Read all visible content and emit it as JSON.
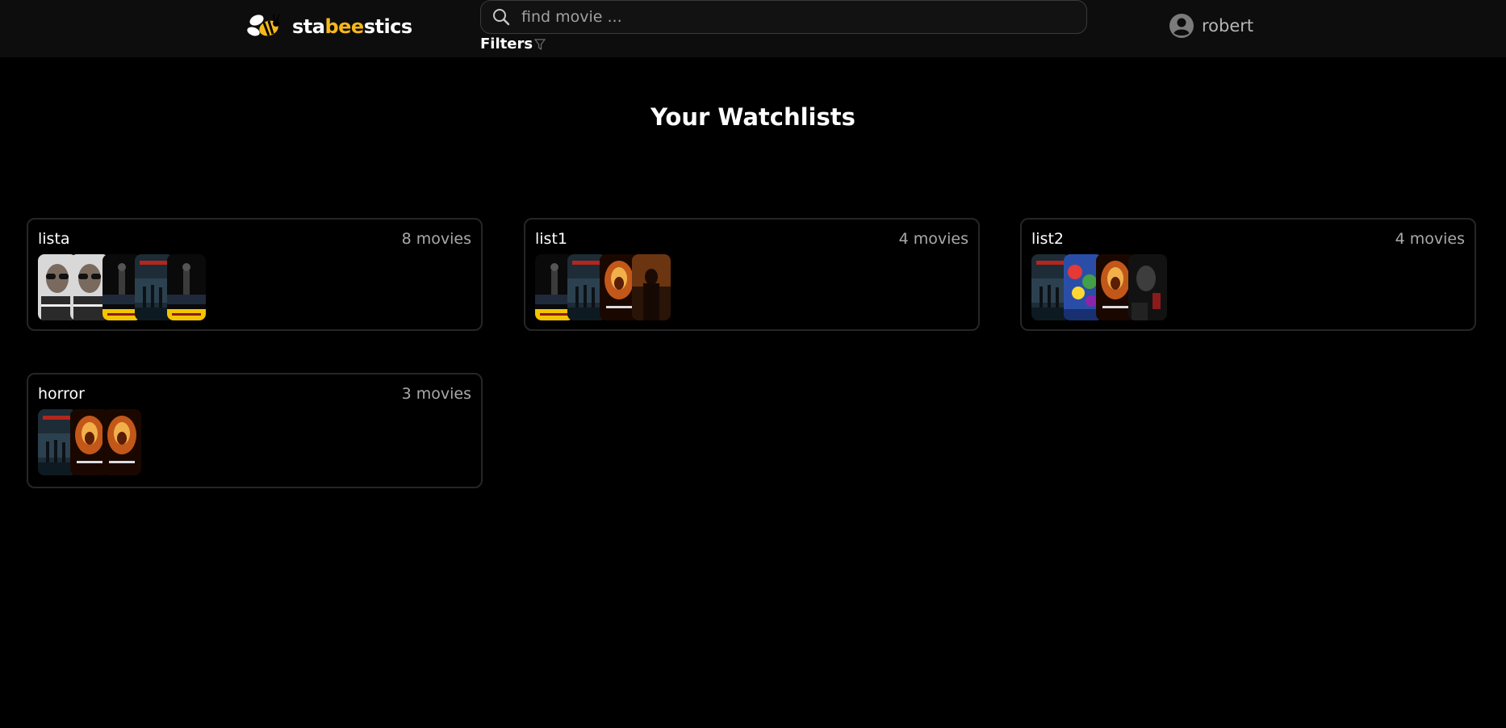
{
  "header": {
    "brand_part1": "sta",
    "brand_part2": "bee",
    "brand_part3": "stics",
    "search_placeholder": "find movie ...",
    "filters_label": "Filters",
    "username": "robert"
  },
  "page": {
    "title": "Your Watchlists"
  },
  "colors": {
    "accent": "#f6b81b",
    "background": "#000000",
    "topbar": "#0d0d0d"
  },
  "watchlists": [
    {
      "name": "lista",
      "count": "8 movies",
      "posters": [
        "nightcrawler",
        "nightcrawler",
        "taxi-driver",
        "inception",
        "taxi-driver"
      ]
    },
    {
      "name": "list1",
      "count": "4 movies",
      "posters": [
        "taxi-driver",
        "inception",
        "fire",
        "dark-figure"
      ]
    },
    {
      "name": "list2",
      "count": "4 movies",
      "posters": [
        "inception",
        "colorful",
        "fire",
        "dark-face"
      ]
    },
    {
      "name": "horror",
      "count": "3 movies",
      "posters": [
        "inception",
        "fire",
        "fire"
      ]
    }
  ]
}
